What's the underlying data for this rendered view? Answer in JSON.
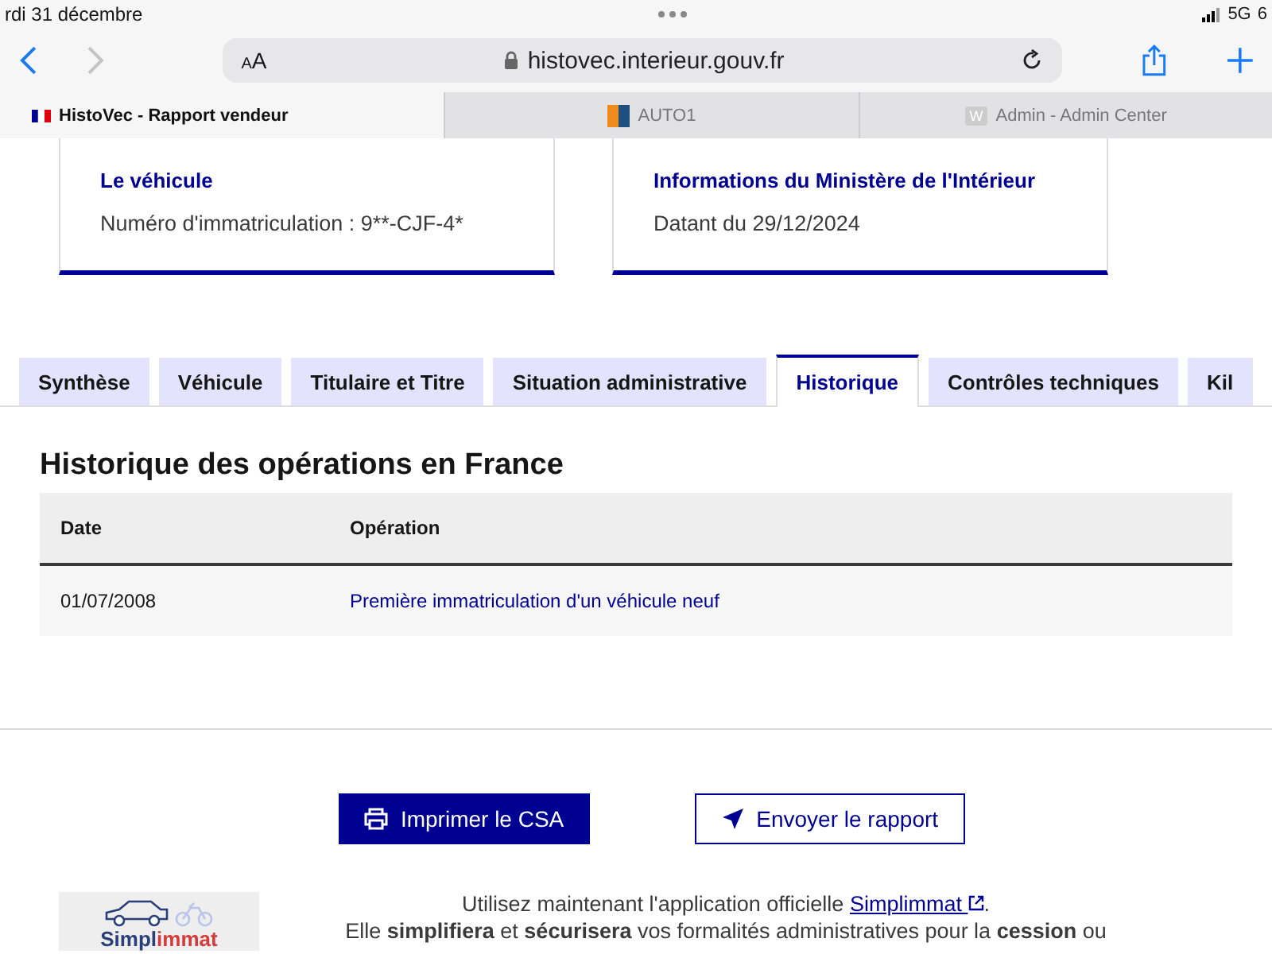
{
  "status_bar": {
    "date": "rdi 31 décembre",
    "network": "5G",
    "battery": "6"
  },
  "browser": {
    "text_size": "AA",
    "url": "histovec.interieur.gouv.fr",
    "tabs": [
      {
        "label": "HistoVec - Rapport vendeur",
        "selected": true,
        "kind": "flag"
      },
      {
        "label": "AUTO1",
        "selected": false,
        "kind": "square"
      },
      {
        "label": "Admin - Admin Center",
        "selected": false,
        "kind": "letter",
        "icon_letter": "W"
      }
    ]
  },
  "cards": [
    {
      "title": "Le véhicule",
      "text": "Numéro d'immatriculation : 9**-CJF-4*"
    },
    {
      "title": "Informations du Ministère de l'Intérieur",
      "text": "Datant du 29/12/2024"
    }
  ],
  "page_tabs": [
    {
      "label": "Synthèse",
      "selected": false
    },
    {
      "label": "Véhicule",
      "selected": false
    },
    {
      "label": "Titulaire et Titre",
      "selected": false
    },
    {
      "label": "Situation administrative",
      "selected": false
    },
    {
      "label": "Historique",
      "selected": true
    },
    {
      "label": "Contrôles techniques",
      "selected": false
    },
    {
      "label": "Kil",
      "selected": false
    }
  ],
  "section": {
    "title": "Historique des opérations en France",
    "table": {
      "columns": [
        "Date",
        "Opération"
      ],
      "rows": [
        [
          "01/07/2008",
          "Première immatriculation d'un véhicule neuf"
        ]
      ]
    }
  },
  "buttons": [
    {
      "label": "Imprimer le CSA",
      "kind": "primary"
    },
    {
      "label": "Envoyer le rapport",
      "kind": "secondary"
    }
  ],
  "promo": {
    "logo_a": "Simpl",
    "logo_b": "immat",
    "line_before": "Utilisez maintenant l'application officielle",
    "link": "Simplimmat",
    "line_after": ".",
    "line_2": "Elle **simplifiera** et **sécurisera** vos formalités administratives pour la **cession** ou"
  }
}
